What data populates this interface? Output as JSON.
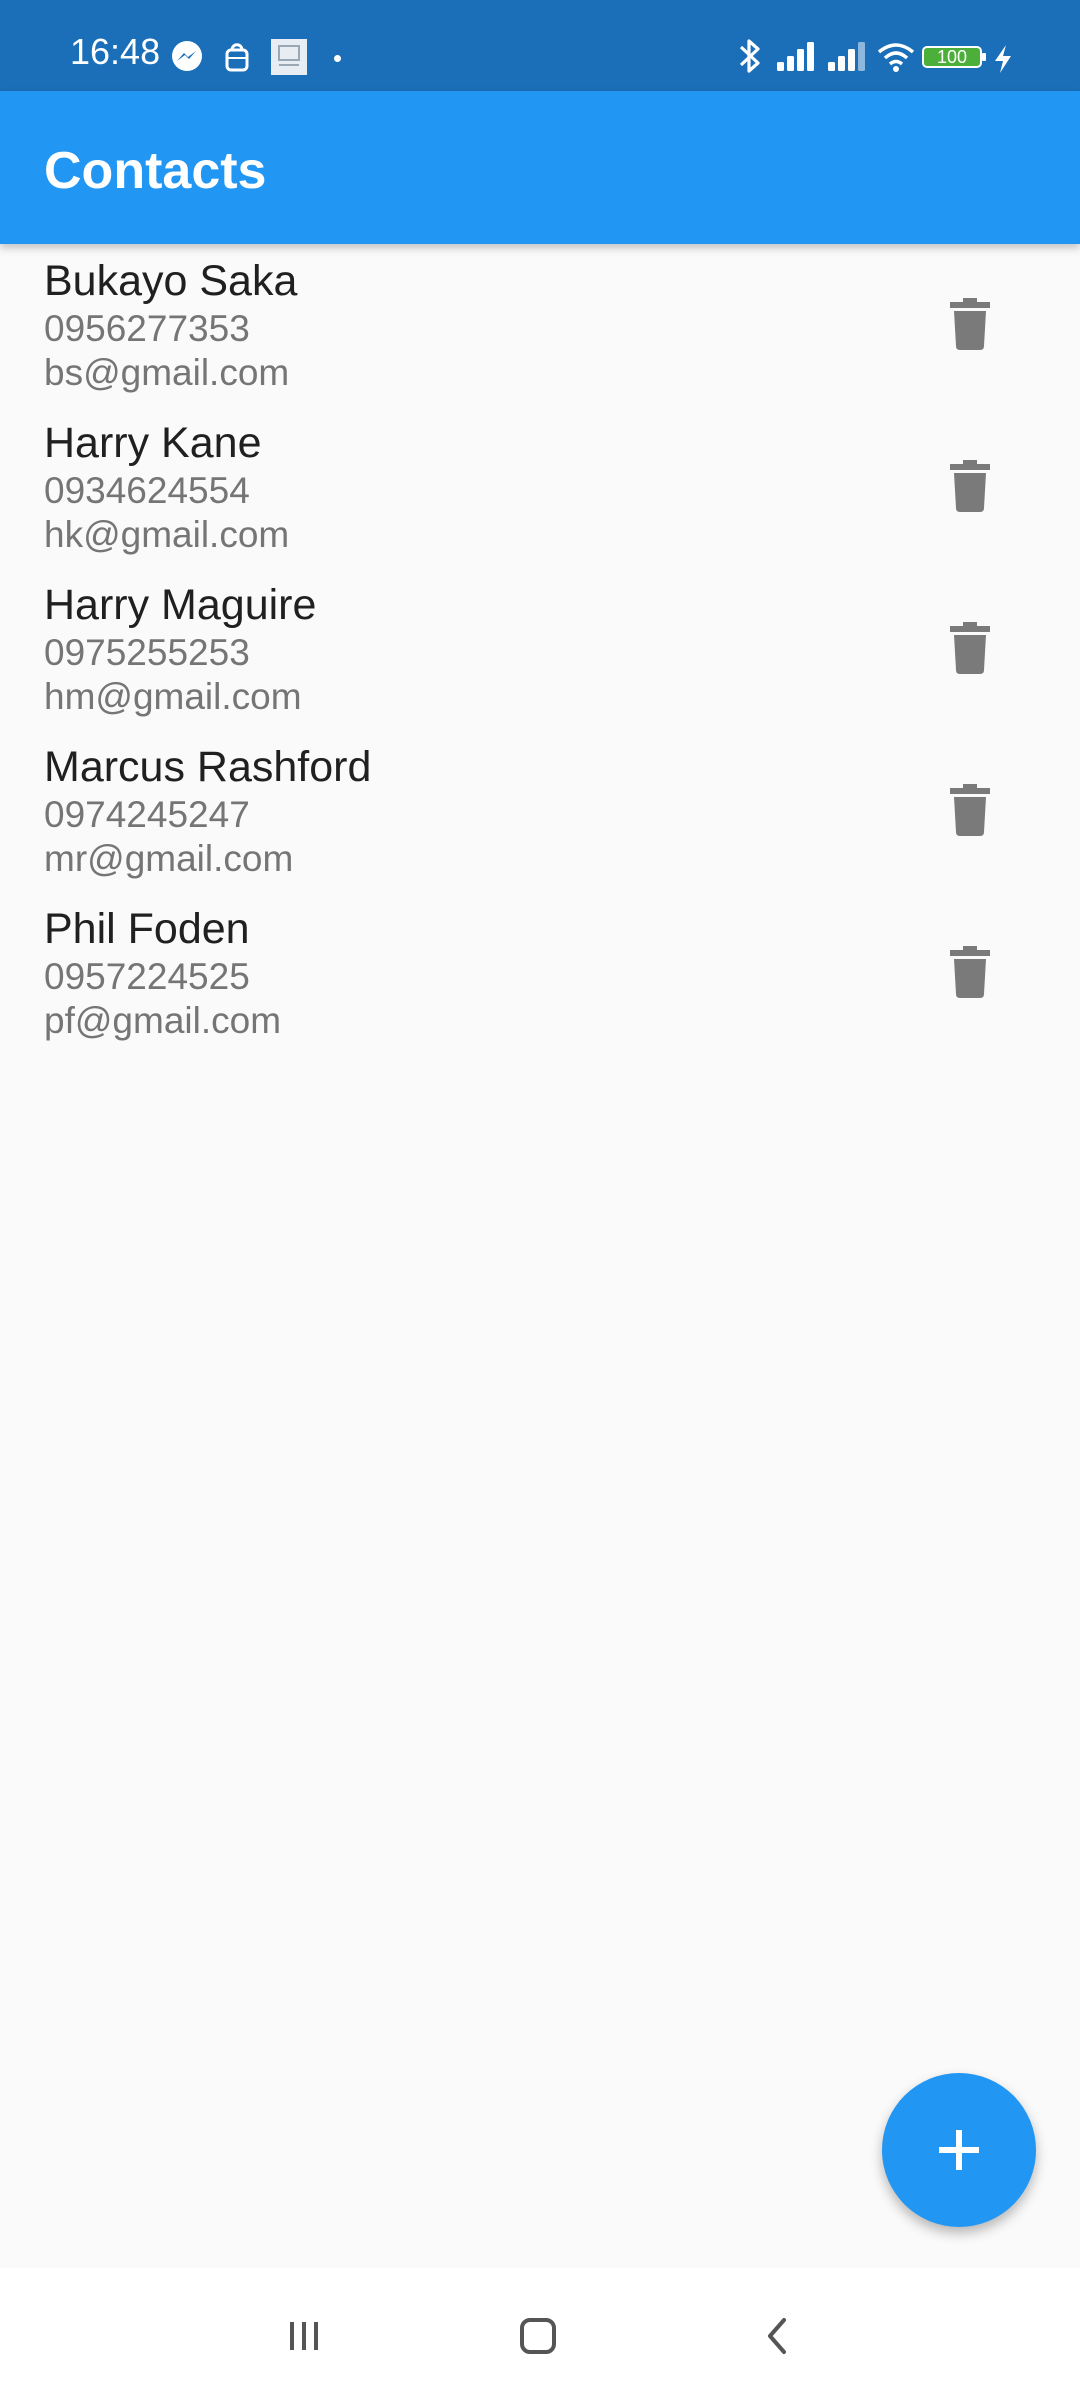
{
  "status_bar": {
    "time": "16:48",
    "battery": "100",
    "icons": [
      "messenger-icon",
      "shopping-bag-icon",
      "gallery-thumbnail-icon",
      "notification-dot-icon",
      "bluetooth-icon",
      "signal-icon",
      "signal-icon",
      "wifi-icon",
      "battery-icon",
      "charging-icon"
    ]
  },
  "app_bar": {
    "title": "Contacts"
  },
  "contacts": [
    {
      "name": "Bukayo Saka",
      "phone": "0956277353",
      "email": "bs@gmail.com"
    },
    {
      "name": "Harry Kane",
      "phone": "0934624554",
      "email": "hk@gmail.com"
    },
    {
      "name": "Harry Maguire",
      "phone": "0975255253",
      "email": "hm@gmail.com"
    },
    {
      "name": "Marcus Rashford",
      "phone": "0974245247",
      "email": "mr@gmail.com"
    },
    {
      "name": "Phil Foden",
      "phone": "0957224525",
      "email": "pf@gmail.com"
    }
  ],
  "actions": {
    "delete_icon": "trash-icon",
    "add_icon": "plus-icon"
  },
  "colors": {
    "status_bar": "#1a6fb8",
    "app_bar": "#2196f3",
    "fab": "#2196f3",
    "background": "#fafafa",
    "icon_gray": "#7a7a7a"
  },
  "nav_bar": {
    "buttons": [
      "recent-apps-icon",
      "home-icon",
      "back-icon"
    ]
  }
}
